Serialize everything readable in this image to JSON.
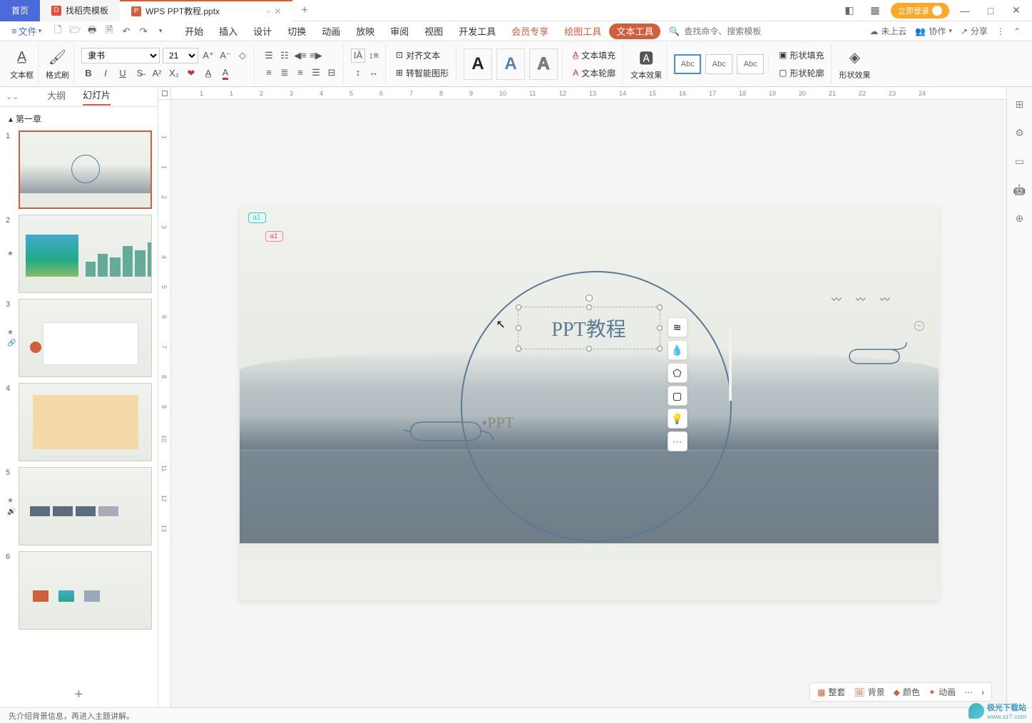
{
  "title_bar": {
    "home": "首页",
    "template": "找稻壳模板",
    "doc": "WPS PPT教程.pptx",
    "login": "立即登录"
  },
  "menu": {
    "file": "文件",
    "tabs": [
      "开始",
      "插入",
      "设计",
      "切换",
      "动画",
      "放映",
      "审阅",
      "视图",
      "开发工具",
      "会员专享"
    ],
    "draw_tool": "绘图工具",
    "text_tool": "文本工具",
    "search_placeholder": "查找命令、搜索模板",
    "not_cloud": "未上云",
    "collab": "协作",
    "share": "分享"
  },
  "ribbon": {
    "textbox": "文本框",
    "format_painter": "格式刷",
    "font_name": "隶书",
    "font_size": "21",
    "align_text": "对齐文本",
    "smart_shape": "转智能图形",
    "text_fill": "文本填充",
    "text_outline": "文本轮廓",
    "text_effects": "文本效果",
    "abc": "Abc",
    "shape_fill": "形状填充",
    "shape_outline": "形状轮廓",
    "shape_effects": "形状效果"
  },
  "left_panel": {
    "outline": "大纲",
    "slides": "幻灯片",
    "section": "第一章",
    "slide_count": 6
  },
  "slide": {
    "title": "PPT教程",
    "subtitle": "•PPT",
    "comment1": "a1",
    "comment2": "a1"
  },
  "canvas_bottom": {
    "suite": "整套",
    "background": "背景",
    "color": "颜色",
    "animation": "动画"
  },
  "status": {
    "notes_hint": "先介绍背景信息，再进入主题讲解。"
  },
  "watermark": {
    "name": "极光下载站",
    "url": "www.xz7.com"
  },
  "ruler_h": [
    "1",
    "1",
    "2",
    "3",
    "4",
    "5",
    "6",
    "7",
    "8",
    "9",
    "10",
    "11",
    "12",
    "13",
    "14",
    "15",
    "16",
    "17",
    "18",
    "19",
    "20",
    "21",
    "22",
    "23",
    "24"
  ],
  "ruler_v": [
    "1",
    "1",
    "2",
    "3",
    "4",
    "5",
    "6",
    "7",
    "8",
    "9",
    "10",
    "11",
    "12",
    "13"
  ]
}
